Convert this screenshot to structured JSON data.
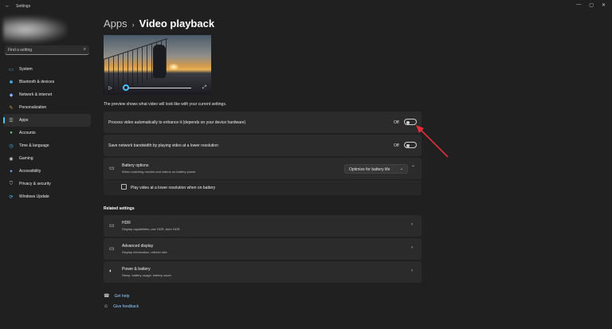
{
  "window": {
    "title": "Settings",
    "back_glyph": "←",
    "controls": [
      "—",
      "▢",
      "✕"
    ]
  },
  "search": {
    "placeholder": "Find a setting",
    "icon": "search-icon"
  },
  "sidebar": {
    "items": [
      {
        "label": "System",
        "icon": "system-icon",
        "glyph": "▭",
        "color": "#4cc2ff",
        "active": false
      },
      {
        "label": "Bluetooth & devices",
        "icon": "bluetooth-icon",
        "glyph": "✱",
        "color": "#4cc2ff",
        "active": false
      },
      {
        "label": "Network & internet",
        "icon": "network-icon",
        "glyph": "◆",
        "color": "#8ab4ff",
        "active": false
      },
      {
        "label": "Personalization",
        "icon": "brush-icon",
        "glyph": "✎",
        "color": "#e3a15a",
        "active": false
      },
      {
        "label": "Apps",
        "icon": "apps-icon",
        "glyph": "☰",
        "color": "#c9c9c9",
        "active": true
      },
      {
        "label": "Accounts",
        "icon": "accounts-icon",
        "glyph": "●",
        "color": "#5fd18a",
        "active": false
      },
      {
        "label": "Time & language",
        "icon": "clock-icon",
        "glyph": "◷",
        "color": "#4cc2ff",
        "active": false
      },
      {
        "label": "Gaming",
        "icon": "gaming-icon",
        "glyph": "◉",
        "color": "#c9c9c9",
        "active": false
      },
      {
        "label": "Accessibility",
        "icon": "accessibility-icon",
        "glyph": "✦",
        "color": "#6fb8ff",
        "active": false
      },
      {
        "label": "Privacy & security",
        "icon": "shield-icon",
        "glyph": "⛉",
        "color": "#c9c9c9",
        "active": false
      },
      {
        "label": "Windows Update",
        "icon": "update-icon",
        "glyph": "⟳",
        "color": "#4cc2ff",
        "active": false
      }
    ]
  },
  "breadcrumb": {
    "parent": "Apps",
    "separator": "›",
    "current": "Video playback"
  },
  "preview": {
    "play_glyph": "▷",
    "expand_glyph": "⤢"
  },
  "description": "The preview shows what video will look like with your current settings.",
  "settings": {
    "process_video": {
      "label": "Process video automatically to enhance it (depends on your device hardware)",
      "state": "Off"
    },
    "save_bandwidth": {
      "label": "Save network bandwidth by playing video at a lower resolution",
      "state": "Off"
    },
    "battery": {
      "title": "Battery options",
      "subtitle": "When watching movies and videos on battery power",
      "dropdown_value": "Optimize for battery life",
      "checkbox_label": "Play video at a lower resolution when on battery"
    }
  },
  "related": {
    "heading": "Related settings",
    "items": [
      {
        "title": "HDR",
        "subtitle": "Display capabilities, use HDR, Auto HDR",
        "icon": "hdr-icon",
        "glyph": "▭"
      },
      {
        "title": "Advanced display",
        "subtitle": "Display information, refresh rate",
        "icon": "monitor-icon",
        "glyph": "▭"
      },
      {
        "title": "Power & battery",
        "subtitle": "Sleep, battery usage, battery saver",
        "icon": "power-icon",
        "glyph": "◐"
      }
    ]
  },
  "help": {
    "get_help": "Get help",
    "give_feedback": "Give feedback"
  },
  "colors": {
    "accent": "#4cc2ff",
    "annotation": "#e0303a"
  }
}
